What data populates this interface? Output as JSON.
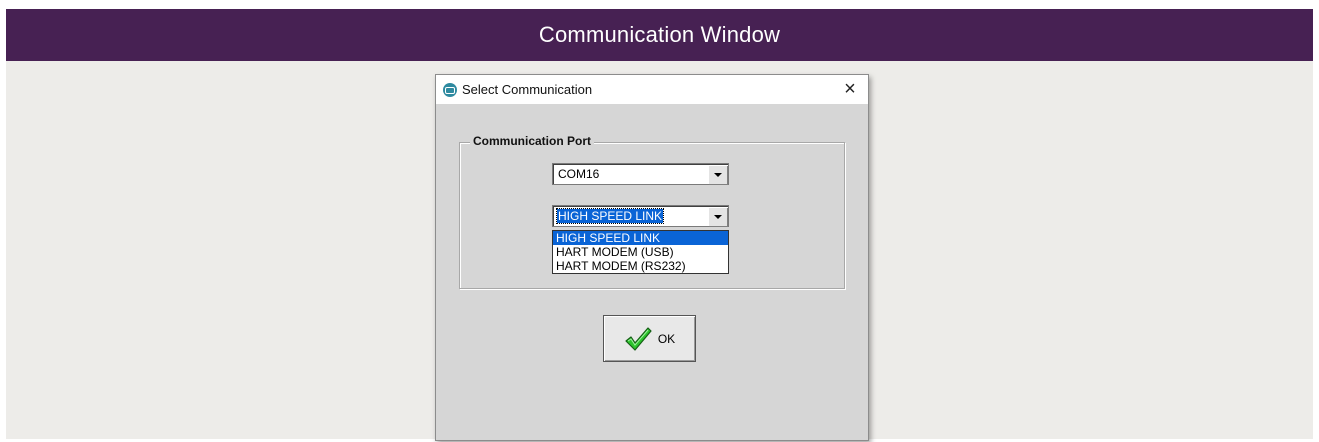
{
  "banner": {
    "title": "Communication Window"
  },
  "dialog": {
    "title": "Select Communication",
    "close_glyph": "×",
    "app_icon": "app-icon",
    "group_label": "Communication Port",
    "port_select": {
      "value": "COM16"
    },
    "link_select": {
      "value": "HIGH SPEED LINK",
      "expanded": true,
      "options": [
        "HIGH SPEED LINK",
        "HART MODEM (USB)",
        "HART MODEM (RS232)"
      ],
      "selected_index": 0
    },
    "ok_button": {
      "label": "OK",
      "icon": "checkmark-icon"
    }
  },
  "colors": {
    "banner_bg": "#472153",
    "selection": "#0a64d6",
    "dialog_bg": "#d6d6d6",
    "check_green": "#2cc42c"
  }
}
